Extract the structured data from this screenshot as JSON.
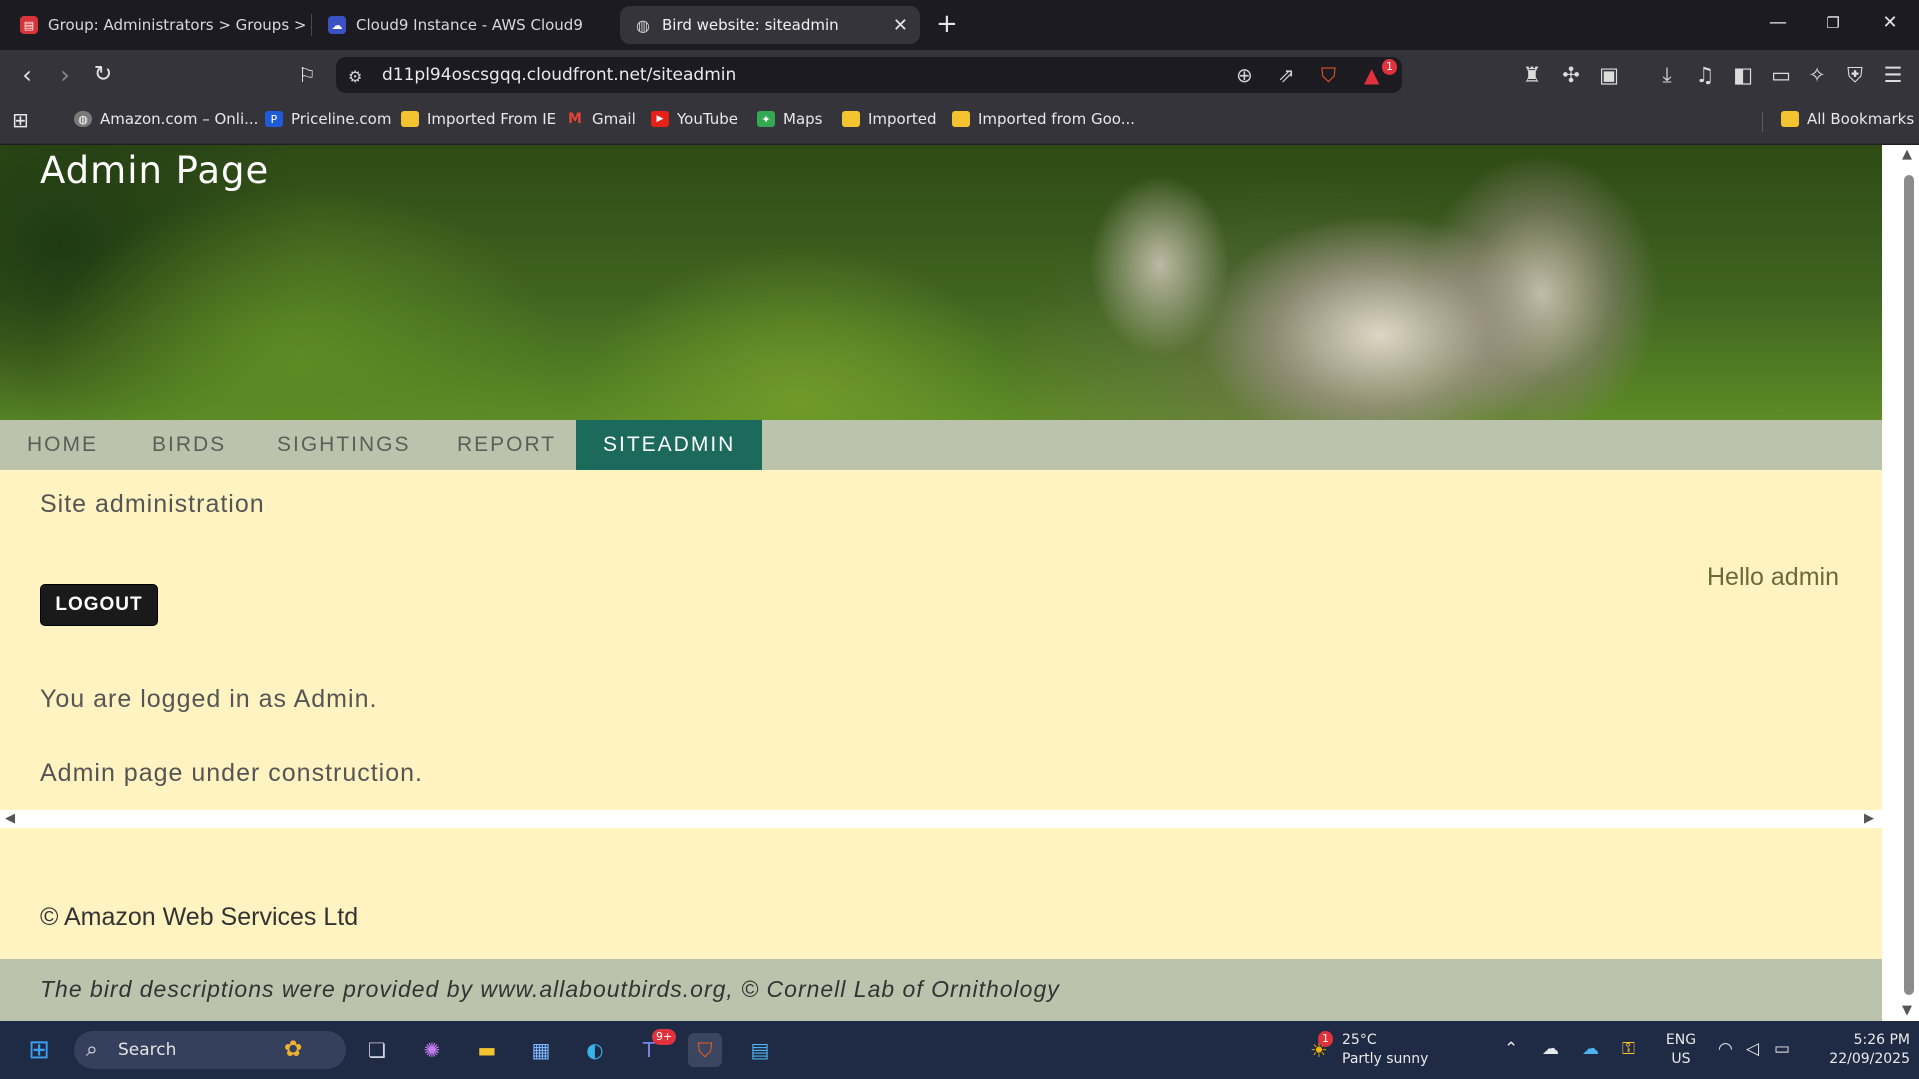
{
  "browser": {
    "tabs": [
      {
        "title": "Group: Administrators > Groups > bi",
        "active": false
      },
      {
        "title": "Cloud9 Instance - AWS Cloud9",
        "active": false
      },
      {
        "title": "Bird website: siteadmin",
        "active": true
      }
    ],
    "new_tab": "+",
    "url": "d11pl94oscsgqq.cloudfront.net/siteadmin",
    "shield_count": "1",
    "bookmarks": [
      {
        "label": "Amazon.com – Onli..."
      },
      {
        "label": "Priceline.com"
      },
      {
        "label": "Imported From IE"
      },
      {
        "label": "Gmail"
      },
      {
        "label": "YouTube"
      },
      {
        "label": "Maps"
      },
      {
        "label": "Imported"
      },
      {
        "label": "Imported from Goo..."
      }
    ],
    "all_bookmarks": "All Bookmarks"
  },
  "page": {
    "banner_title": "Admin Page",
    "menu": [
      {
        "label": "HOME",
        "active": false
      },
      {
        "label": "BIRDS",
        "active": false
      },
      {
        "label": "SIGHTINGS",
        "active": false
      },
      {
        "label": "REPORT",
        "active": false
      },
      {
        "label": "SITEADMIN",
        "active": true
      }
    ],
    "section_title": "Site administration",
    "greeting": "Hello admin",
    "logout_label": "LOGOUT",
    "logged_in_text": "You are logged in as Admin.",
    "construction_text": "Admin page under construction.",
    "copyright": "© Amazon Web Services Ltd",
    "footer_credit": "The bird descriptions were provided by www.allaboutbirds.org, © Cornell Lab of Ornithology"
  },
  "taskbar": {
    "search_label": "Search",
    "teams_badge": "9+",
    "weather_badge": "1",
    "weather_temp": "25°C",
    "weather_desc": "Partly sunny",
    "lang_top": "ENG",
    "lang_bottom": "US",
    "time": "5:26 PM",
    "date": "22/09/2025"
  }
}
